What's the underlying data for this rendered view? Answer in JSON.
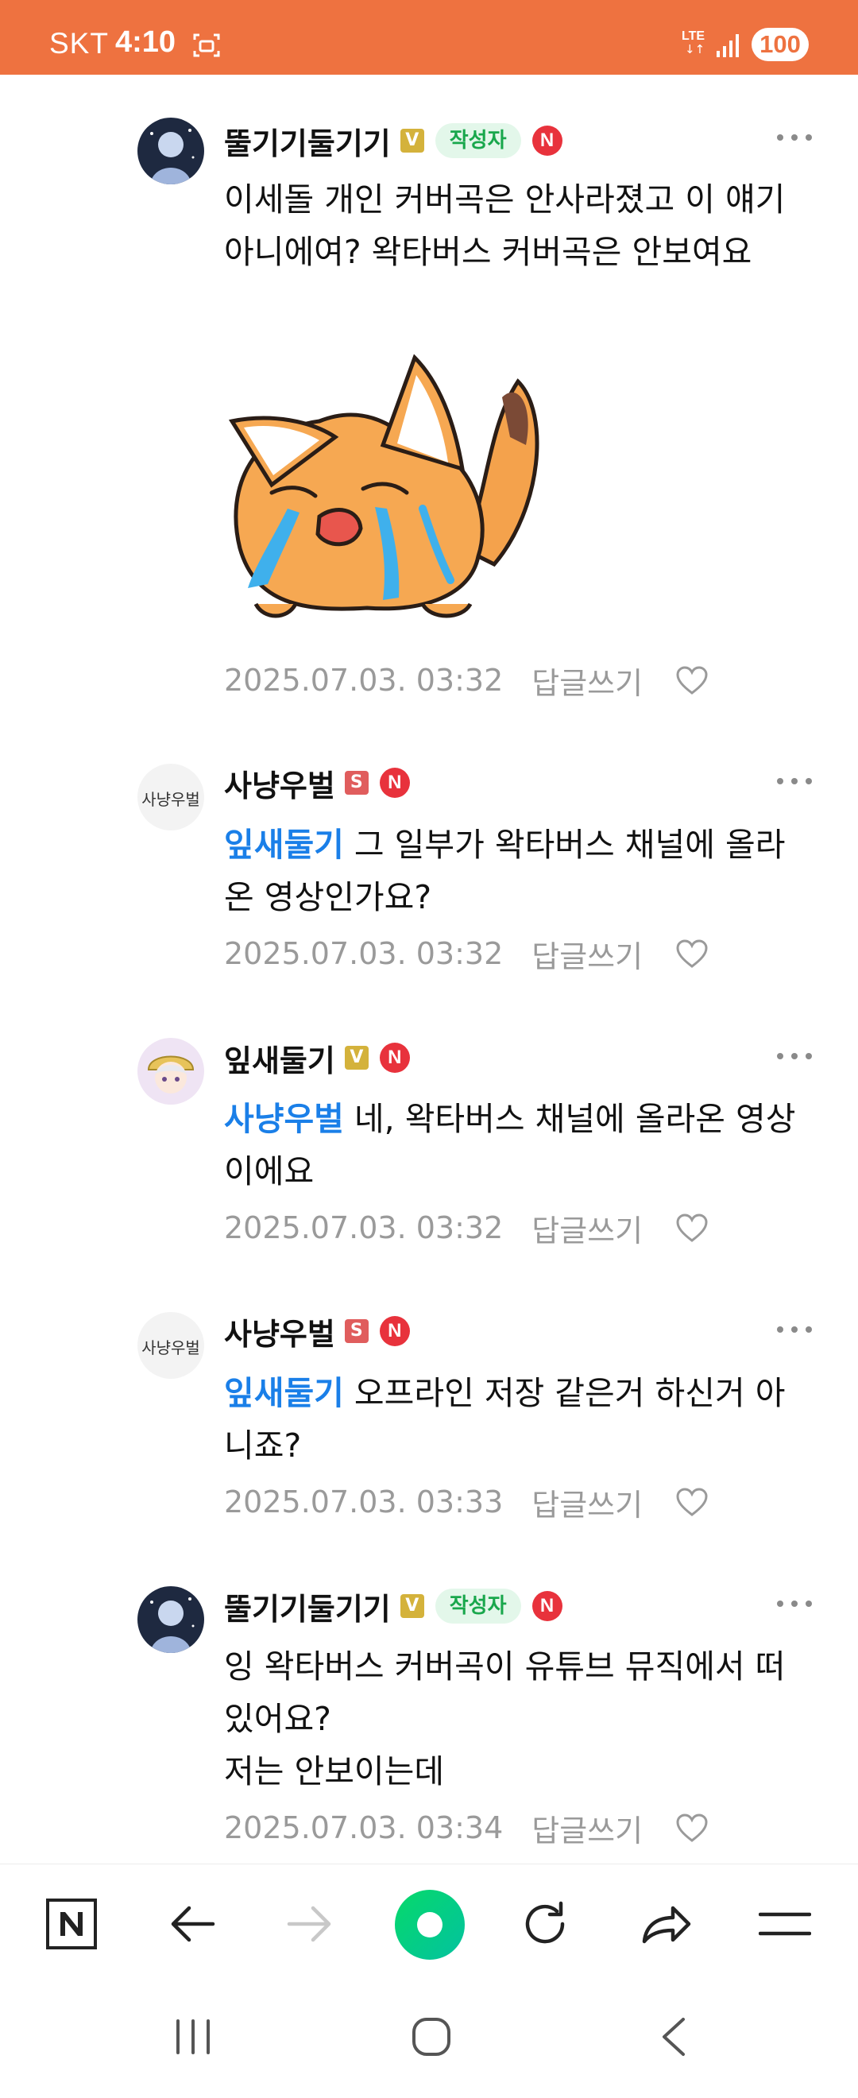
{
  "status_bar": {
    "carrier": "SKT",
    "time": "4:10",
    "network": "LTE",
    "battery": "100",
    "background": "#ee7240"
  },
  "comments": [
    {
      "nickname": "뚤기기둘기기",
      "badges": [
        "v-badge",
        "author-tag",
        "n-badge"
      ],
      "author_tag": "작성자",
      "n_badge": "N",
      "mention": "",
      "text": "이세돌 개인 커버곡은 안사라졌고 이 얘기 아니에여? 왁타버스 커버곡은 안보여요",
      "has_sticker": true,
      "sticker": "crying-fox-sticker",
      "date": "2025.07.03. 03:32",
      "reply_label": "답글쓰기"
    },
    {
      "nickname": "사냥우벌",
      "badges": [
        "s-badge",
        "n-badge"
      ],
      "s_badge": "S",
      "n_badge": "N",
      "mention": "잎새둘기",
      "text": " 그 일부가 왁타버스 채널에 올라온 영상인가요?",
      "date": "2025.07.03. 03:32",
      "reply_label": "답글쓰기"
    },
    {
      "nickname": "잎새둘기",
      "badges": [
        "v-badge",
        "n-badge"
      ],
      "n_badge": "N",
      "mention": "사냥우벌",
      "text": " 네, 왁타버스 채널에 올라온 영상이에요",
      "date": "2025.07.03. 03:32",
      "reply_label": "답글쓰기"
    },
    {
      "nickname": "사냥우벌",
      "badges": [
        "s-badge",
        "n-badge"
      ],
      "s_badge": "S",
      "n_badge": "N",
      "mention": "잎새둘기",
      "text": " 오프라인 저장 같은거 하신거 아니죠?",
      "date": "2025.07.03. 03:33",
      "reply_label": "답글쓰기"
    },
    {
      "nickname": "뚤기기둘기기",
      "badges": [
        "v-badge",
        "author-tag",
        "n-badge"
      ],
      "author_tag": "작성자",
      "n_badge": "N",
      "mention": "",
      "text": "잉 왁타버스 커버곡이 유튜브 뮤직에서 떠있어요?\n저는 안보이는데",
      "date": "2025.07.03. 03:34",
      "reply_label": "답글쓰기"
    }
  ],
  "toolbar": {
    "items": [
      "naver-home-icon",
      "back-arrow-icon",
      "forward-arrow-icon",
      "green-dot-icon",
      "refresh-icon",
      "share-icon",
      "menu-icon"
    ],
    "accent": "#03c75a"
  },
  "nav_bar": {
    "items": [
      "recent-apps-icon",
      "home-icon",
      "back-icon"
    ]
  },
  "colors": {
    "mention": "#1a7fe8",
    "meta": "#9a9a9a",
    "author_tag_bg": "#e3f7ea",
    "author_tag_fg": "#19a74c",
    "n_badge": "#e8323c"
  }
}
